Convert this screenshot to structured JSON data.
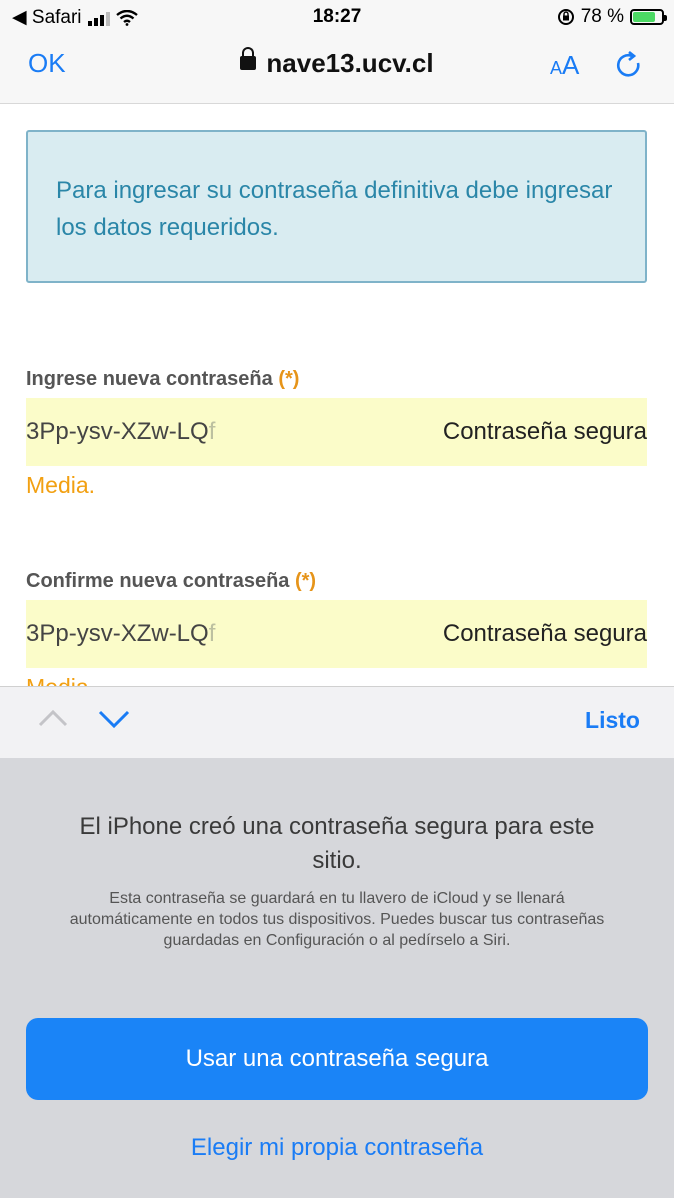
{
  "status_bar": {
    "back_app": "◀ Safari",
    "time": "18:27",
    "battery": "78 %",
    "battery_level": 0.78
  },
  "nav": {
    "ok": "OK",
    "url": "nave13.ucv.cl",
    "text_size": "AA"
  },
  "info_message": "Para ingresar su contraseña definitiva debe ingresar los datos requeridos.",
  "fields": [
    {
      "label": "Ingrese nueva contraseña",
      "required_mark": "(*)",
      "value": "3Pp-ysv-XZw-LQ",
      "value_fade": "f",
      "hint": "Contraseña segura",
      "strength": "Media."
    },
    {
      "label": "Confirme nueva contraseña",
      "required_mark": "(*)",
      "value": "3Pp-ysv-XZw-LQ",
      "value_fade": "f",
      "hint": "Contraseña segura",
      "strength": "Media."
    }
  ],
  "accessory": {
    "done": "Listo"
  },
  "sheet": {
    "title": "El iPhone creó una contraseña segura para este sitio.",
    "description": "Esta contraseña se guardará en tu llavero de iCloud y se llenará automáticamente en todos tus dispositivos. Puedes buscar tus contraseñas guardadas en Configuración o al pedírselo a Siri.",
    "use_strong": "Usar una contraseña segura",
    "choose_own": "Elegir mi propia contraseña"
  }
}
